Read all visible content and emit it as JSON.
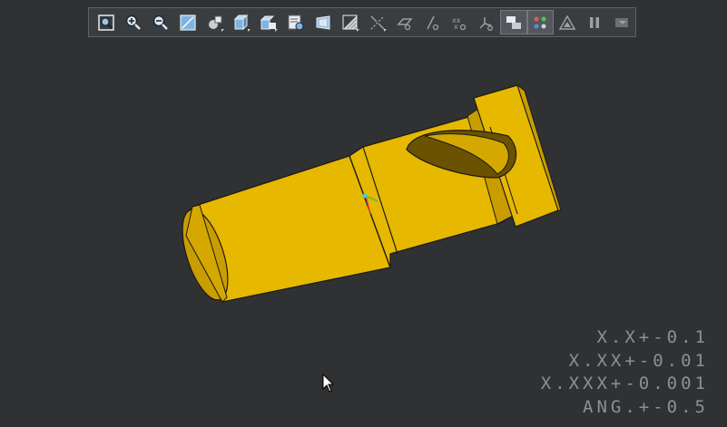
{
  "toolbar": {
    "buttons": [
      {
        "icon": "refit-icon",
        "active": false
      },
      {
        "icon": "zoom-in-icon",
        "active": false
      },
      {
        "icon": "zoom-out-icon",
        "active": false
      },
      {
        "icon": "repaint-icon",
        "active": false
      },
      {
        "icon": "orient-icon",
        "active": false,
        "submenu": true
      },
      {
        "icon": "display-style-icon",
        "active": false,
        "submenu": true
      },
      {
        "icon": "saved-views-icon",
        "active": false,
        "submenu": true
      },
      {
        "icon": "view-manager-icon",
        "active": false
      },
      {
        "icon": "perspective-icon",
        "active": false
      },
      {
        "icon": "section-icon",
        "active": false,
        "submenu": true
      },
      {
        "icon": "datum-display-icon",
        "active": false,
        "submenu": true
      },
      {
        "icon": "plane-display-icon",
        "active": false
      },
      {
        "icon": "axis-display-icon",
        "active": false
      },
      {
        "icon": "point-display-icon",
        "active": false
      },
      {
        "icon": "csys-display-icon",
        "active": false
      },
      {
        "icon": "annotation-display-icon",
        "active": true
      },
      {
        "icon": "spin-center-icon",
        "active": true
      },
      {
        "icon": "appearance-icon",
        "active": false
      },
      {
        "icon": "pause-icon",
        "active": false
      },
      {
        "icon": "animation-icon",
        "active": false
      }
    ]
  },
  "tolerance": {
    "line1": "X.X+-0.1",
    "line2": "X.XX+-0.01",
    "line3": "X.XXX+-0.001",
    "line4": "ANG.+-0.5"
  },
  "colors": {
    "background": "#2f3133",
    "part": "#e6b800",
    "part_shadow": "#b78f00"
  }
}
